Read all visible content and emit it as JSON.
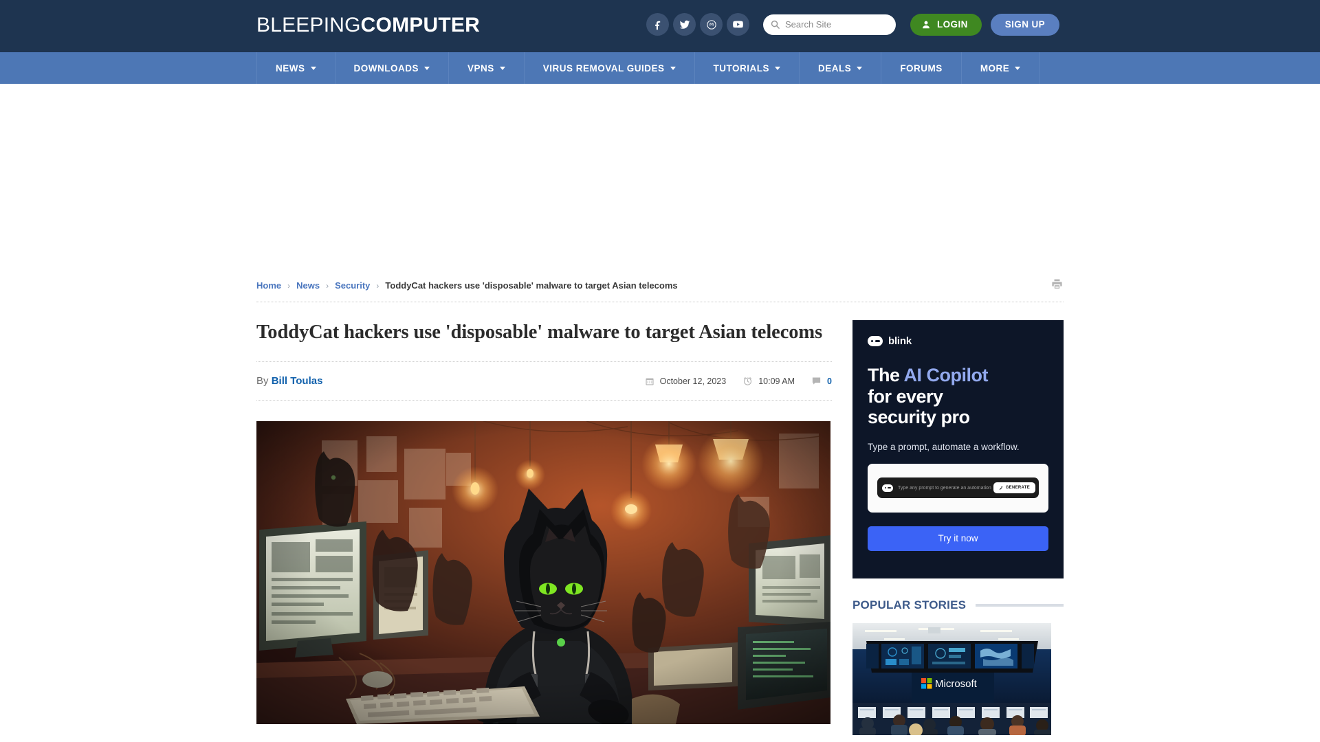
{
  "header": {
    "logo_light": "BLEEPING",
    "logo_bold": "COMPUTER",
    "social": [
      {
        "name": "facebook-icon",
        "label": "Facebook"
      },
      {
        "name": "twitter-icon",
        "label": "Twitter"
      },
      {
        "name": "mastodon-icon",
        "label": "Mastodon"
      },
      {
        "name": "youtube-icon",
        "label": "YouTube"
      }
    ],
    "search": {
      "placeholder": "Search Site",
      "value": "",
      "icon": "search-icon"
    },
    "login_label": "LOGIN",
    "signup_label": "SIGN UP",
    "colors": {
      "header_bg": "#1e3450",
      "nav_bg": "#4d77b5",
      "login_green": "#3f8821",
      "signup_blue": "#5a7fc0"
    }
  },
  "nav": {
    "items": [
      {
        "label": "NEWS",
        "has_dropdown": true
      },
      {
        "label": "DOWNLOADS",
        "has_dropdown": true
      },
      {
        "label": "VPNS",
        "has_dropdown": true
      },
      {
        "label": "VIRUS REMOVAL GUIDES",
        "has_dropdown": true
      },
      {
        "label": "TUTORIALS",
        "has_dropdown": true
      },
      {
        "label": "DEALS",
        "has_dropdown": true
      },
      {
        "label": "FORUMS",
        "has_dropdown": false
      },
      {
        "label": "MORE",
        "has_dropdown": true
      }
    ]
  },
  "breadcrumb": {
    "items": [
      {
        "label": "Home",
        "link": true
      },
      {
        "label": "News",
        "link": true
      },
      {
        "label": "Security",
        "link": true
      },
      {
        "label": "ToddyCat hackers use 'disposable' malware to target Asian telecoms",
        "link": false
      }
    ],
    "separator": "›",
    "print_icon": "printer-icon"
  },
  "article": {
    "title": "ToddyCat hackers use 'disposable' malware to target Asian telecoms",
    "byline_prefix": "By",
    "author": "Bill Toulas",
    "date": "October 12, 2023",
    "time": "10:09 AM",
    "comment_count": "0",
    "icons": {
      "date": "calendar-icon",
      "time": "clock-icon",
      "comments": "comment-icon"
    },
    "hero_alt": "Illustration of a hooded black cat hacker with glowing green eyes typing at a keyboard surrounded by CRT monitors and other cats"
  },
  "sidebar": {
    "ad": {
      "brand": "blink",
      "brand_icon": "blink-logo-icon",
      "headline_part1": "The ",
      "headline_accent": "AI Copilot",
      "headline_part2": "for every",
      "headline_part3": "security pro",
      "subtext": "Type a prompt, automate a workflow.",
      "mock_placeholder": "Type any prompt to generate an automation",
      "mock_button": "GENERATE",
      "cta_label": "Try it now",
      "bg_color": "#0d1628",
      "accent_color": "#92a9ee",
      "cta_color": "#3b63f6"
    },
    "popular": {
      "heading": "POPULAR STORIES",
      "thumb_alt": "Microsoft security operations center with analysts at desks facing large display walls"
    }
  }
}
